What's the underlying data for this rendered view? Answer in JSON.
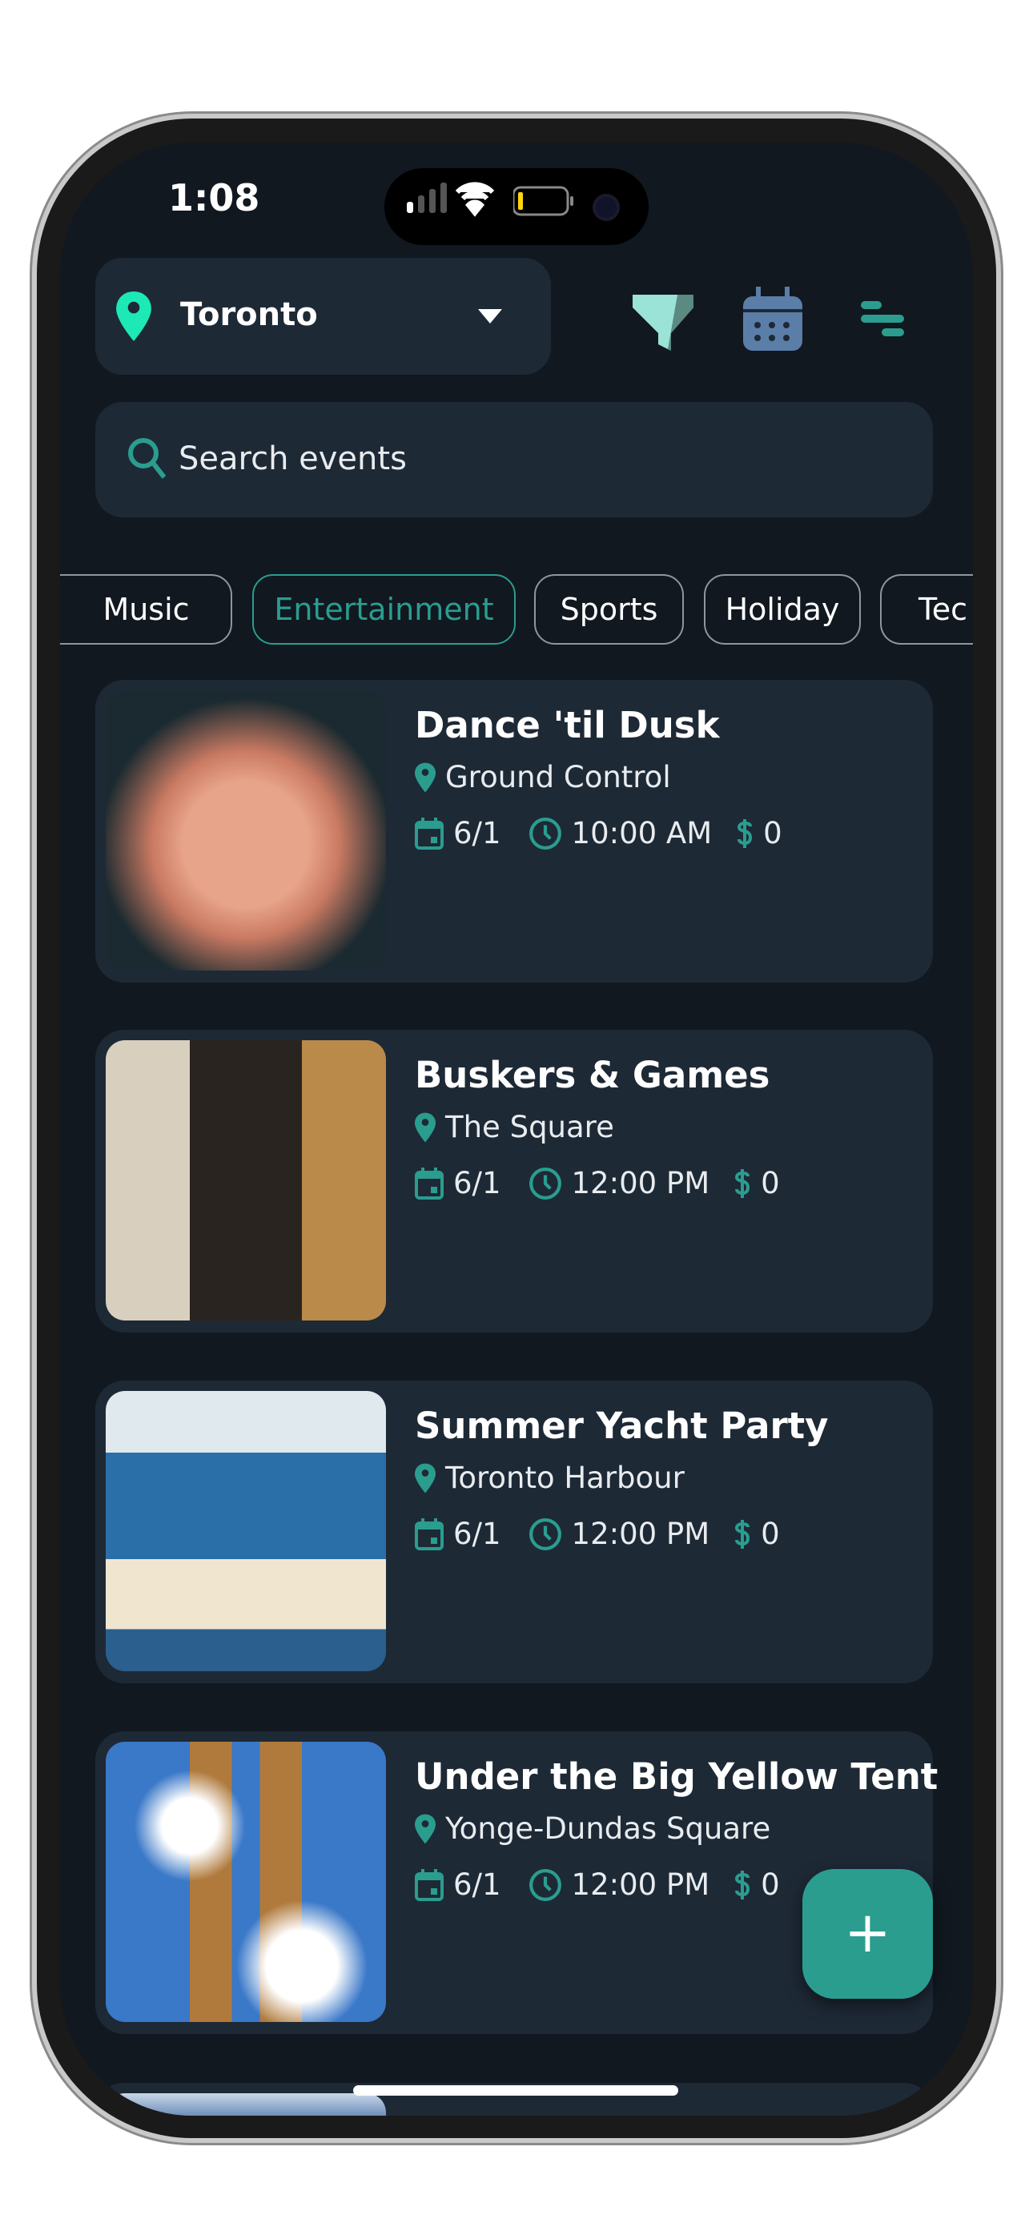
{
  "status_bar": {
    "time": "1:08"
  },
  "header": {
    "location": "Toronto",
    "icons": [
      "map-pin-icon",
      "caret-down-icon",
      "filter-icon",
      "calendar-icon",
      "sort-icon"
    ]
  },
  "search": {
    "placeholder": "Search events"
  },
  "categories": [
    {
      "label": "Music"
    },
    {
      "label": "Entertainment",
      "active": true
    },
    {
      "label": "Sports"
    },
    {
      "label": "Holiday"
    },
    {
      "label": "Tec"
    }
  ],
  "events": [
    {
      "title": "Dance 'til Dusk",
      "venue": "Ground Control",
      "date": "6/1",
      "time": "10:00 AM",
      "price": "0"
    },
    {
      "title": "Buskers & Games",
      "venue": "The Square",
      "date": "6/1",
      "time": "12:00 PM",
      "price": "0"
    },
    {
      "title": "Summer Yacht Party",
      "venue": "Toronto Harbour",
      "date": "6/1",
      "time": "12:00 PM",
      "price": "0"
    },
    {
      "title": "Under the Big Yellow Tent",
      "venue": "Yonge-Dundas Square",
      "date": "6/1",
      "time": "12:00 PM",
      "price": "0"
    }
  ],
  "fab": {
    "label": "+"
  },
  "colors": {
    "accent": "#2a9d8f",
    "background": "#111820",
    "card": "#1e2936",
    "pin": "#1de9b6"
  }
}
